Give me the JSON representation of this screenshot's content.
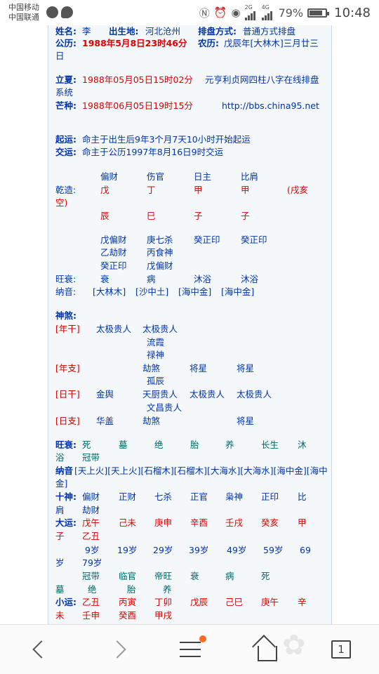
{
  "status_bar": {
    "carrier1": "中国移动",
    "carrier2": "中国联通",
    "net_2g": "2G",
    "net_4g": "4G",
    "battery_pct": "79%",
    "battery_level": 0.79,
    "time": "10:48"
  },
  "header": {
    "name_label": "姓名:",
    "name_value": "李",
    "birthplace_label": "出生地:",
    "birthplace_value": "河北沧州",
    "method_label": "排盘方式:",
    "method_value": "普通方式排盘",
    "gongli_label": "公历:",
    "gongli_value": "1988年5月8日23时46分",
    "nongli_label": "农历:",
    "nongli_value1": "戊辰年[大林木]三月廿三",
    "nongli_value2": "日"
  },
  "jieqi": {
    "lixia_label": "立夏:",
    "lixia_value": "1988年05月05日15时02分",
    "site_name1": "元亨利贞网四柱八字在线排盘",
    "site_name2": "系统",
    "mangzhong_label": "芒种:",
    "mangzhong_value": "1988年06月05日19时15分",
    "site_url": "http://bbs.china95.net"
  },
  "yun": {
    "qiyun_label": "起运:",
    "qiyun_value": "命主于出生后9年3个月7天10小时开始起运",
    "jiaoyun_label": "交运:",
    "jiaoyun_value": "命主于公历1997年8月16日9时交运"
  },
  "bazi": {
    "gods_top": [
      "偏财",
      "伤官",
      "日主",
      "比肩"
    ],
    "qianzao_label": "乾造:",
    "stems": [
      "戊",
      "丁",
      "甲",
      "甲"
    ],
    "kong": "(戌亥",
    "kong2": "空)",
    "branches": [
      "辰",
      "巳",
      "子",
      "子"
    ],
    "hidden": [
      [
        "戊偏财",
        "乙劫财",
        "癸正印"
      ],
      [
        "庚七杀",
        "丙食神",
        "戊偏财"
      ],
      [
        "癸正印"
      ],
      [
        "癸正印"
      ]
    ],
    "wangshuai_label": "旺衰:",
    "wangshuai": [
      "衰",
      "病",
      "沐浴",
      "沐浴"
    ],
    "nayin_label": "纳音:",
    "nayin": [
      "[大林木]",
      "[沙中土]",
      "[海中金]",
      "[海中金]"
    ]
  },
  "shensha": {
    "label": "神煞:",
    "rows": [
      {
        "label": "[年干]",
        "col1": [
          "太极贵人"
        ],
        "col2": [
          "太极贵人",
          "流霞",
          "禄神"
        ],
        "col3": [],
        "col4": []
      },
      {
        "label": "[年支]",
        "col1": [],
        "col2": [
          "劫煞",
          "孤辰"
        ],
        "col3": [
          "将星"
        ],
        "col4": [
          "将星"
        ]
      },
      {
        "label": "[日干]",
        "col1": [
          "金舆"
        ],
        "col2": [
          "天厨贵人",
          "文昌贵人"
        ],
        "col3": [
          "太极贵人"
        ],
        "col4": [
          "太极贵人"
        ]
      },
      {
        "label": "[日支]",
        "col1": [
          "华盖"
        ],
        "col2": [
          "劫煞"
        ],
        "col3": [],
        "col4": [
          "将星"
        ]
      }
    ]
  },
  "lower": {
    "wangshuai_label": "旺衰:",
    "wangshuai_line1": [
      "死",
      "墓",
      "绝",
      "胎",
      "养",
      "长生",
      "沐"
    ],
    "wangshuai_line2": [
      "浴",
      "冠带"
    ],
    "nayin_label": "纳音",
    "nayin_line1": "[天上火][天上火][石榴木][石榴木][大海水][大海水][海中金][海中",
    "nayin_line2": "金]",
    "shishen_label": "十神:",
    "shishen_line1": [
      "偏财",
      "正财",
      "七杀",
      "正官",
      "枭神",
      "正印",
      "比"
    ],
    "shishen_line2": [
      "肩",
      "劫财"
    ],
    "dayun_label": "大运:",
    "dayun_line1": [
      "戊午",
      "己未",
      "庚申",
      "辛酉",
      "壬戌",
      "癸亥",
      "甲"
    ],
    "dayun_line2": [
      "子",
      "乙丑"
    ],
    "ages_line1": [
      "9岁",
      "19岁",
      "29岁",
      "39岁",
      "49岁",
      "59岁",
      "69"
    ],
    "ages_line2": [
      "岁",
      "79岁"
    ],
    "cs_line1": [
      "冠带",
      "临官",
      "帝旺",
      "衰",
      "病",
      "死"
    ],
    "cs_line2": [
      "墓",
      "绝",
      "胎",
      "养"
    ],
    "xiaoyun_label": "小运:",
    "xiaoyun_line1": [
      "乙丑",
      "丙寅",
      "丁卯",
      "戊辰",
      "己巳",
      "庚午",
      "辛"
    ],
    "xiaoyun_line2": [
      "未",
      "壬申",
      "癸酉",
      "甲戌"
    ]
  },
  "nav": {
    "tab_count": "1"
  }
}
